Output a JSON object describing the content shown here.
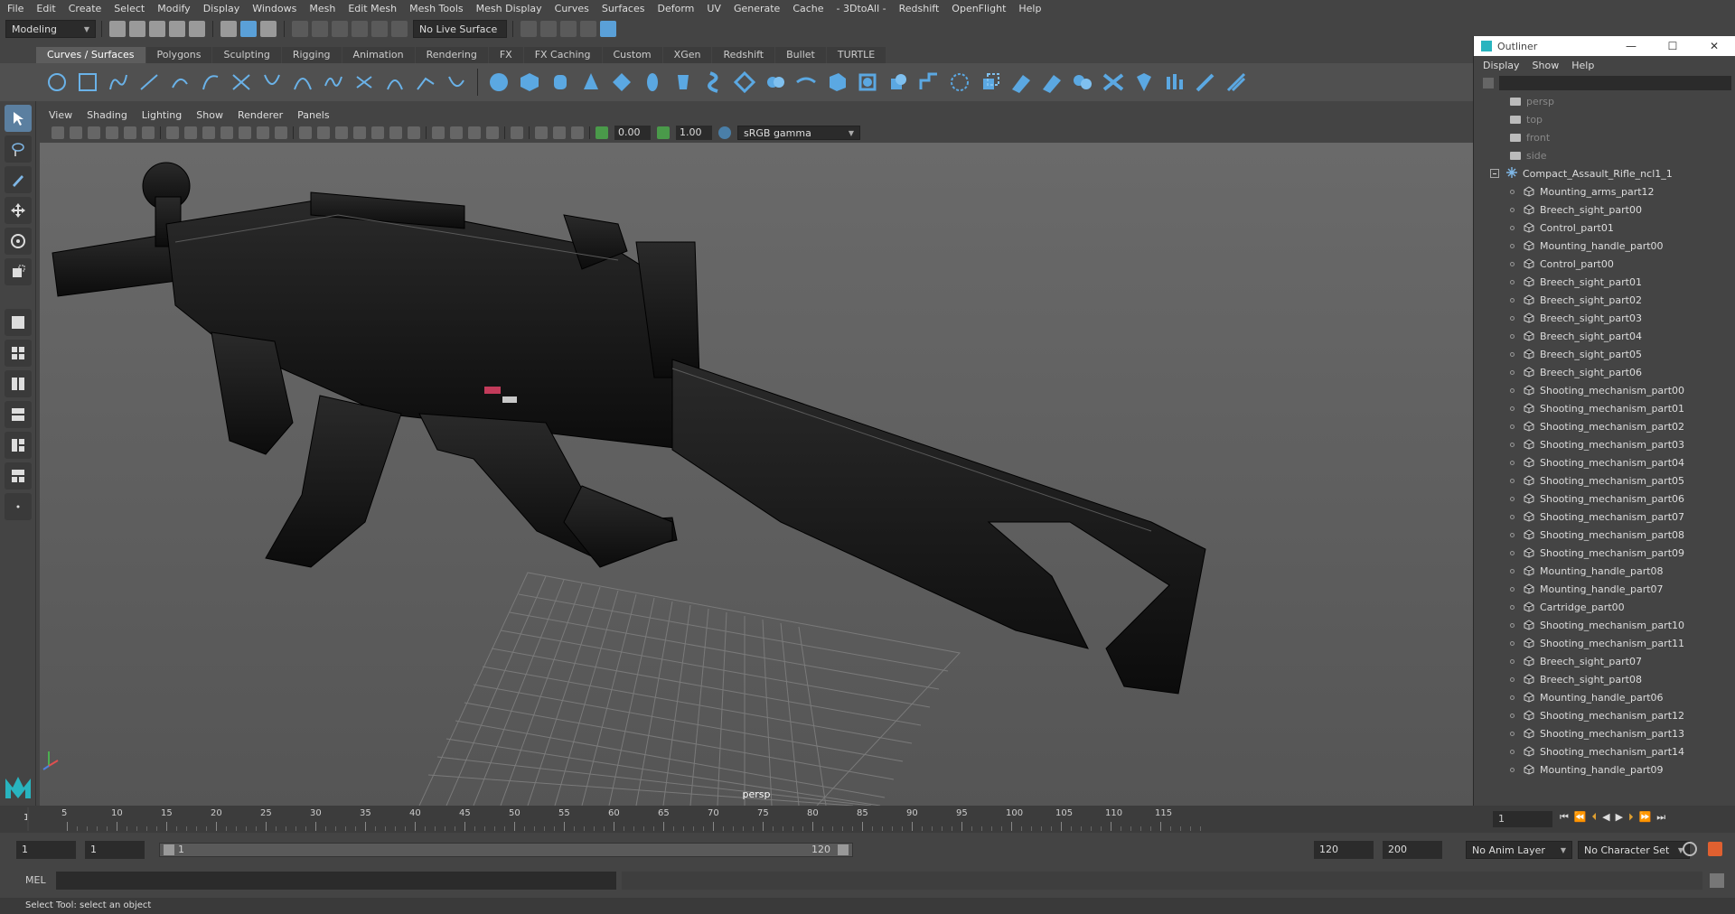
{
  "menubar": [
    "File",
    "Edit",
    "Create",
    "Select",
    "Modify",
    "Display",
    "Windows",
    "Mesh",
    "Edit Mesh",
    "Mesh Tools",
    "Mesh Display",
    "Curves",
    "Surfaces",
    "Deform",
    "UV",
    "Generate",
    "Cache",
    "- 3DtoAll -",
    "Redshift",
    "OpenFlight",
    "Help"
  ],
  "status": {
    "workspace": "Modeling",
    "live_surface": "No Live Surface"
  },
  "shelf_tabs": [
    "Curves / Surfaces",
    "Polygons",
    "Sculpting",
    "Rigging",
    "Animation",
    "Rendering",
    "FX",
    "FX Caching",
    "Custom",
    "XGen",
    "Redshift",
    "Bullet",
    "TURTLE"
  ],
  "view_menu": [
    "View",
    "Shading",
    "Lighting",
    "Show",
    "Renderer",
    "Panels"
  ],
  "view_tools": {
    "exposure": "0.00",
    "gamma": "1.00",
    "color_space": "sRGB gamma"
  },
  "viewport": {
    "camera_label": "persp"
  },
  "outliner": {
    "title": "Outliner",
    "window_buttons": [
      "—",
      "☐",
      "✕"
    ],
    "menu": [
      "Display",
      "Show",
      "Help"
    ],
    "cameras": [
      "persp",
      "top",
      "front",
      "side"
    ],
    "root": "Compact_Assault_Rifle_ncl1_1",
    "children": [
      "Mounting_arms_part12",
      "Breech_sight_part00",
      "Control_part01",
      "Mounting_handle_part00",
      "Control_part00",
      "Breech_sight_part01",
      "Breech_sight_part02",
      "Breech_sight_part03",
      "Breech_sight_part04",
      "Breech_sight_part05",
      "Breech_sight_part06",
      "Shooting_mechanism_part00",
      "Shooting_mechanism_part01",
      "Shooting_mechanism_part02",
      "Shooting_mechanism_part03",
      "Shooting_mechanism_part04",
      "Shooting_mechanism_part05",
      "Shooting_mechanism_part06",
      "Shooting_mechanism_part07",
      "Shooting_mechanism_part08",
      "Shooting_mechanism_part09",
      "Mounting_handle_part08",
      "Mounting_handle_part07",
      "Cartridge_part00",
      "Shooting_mechanism_part10",
      "Shooting_mechanism_part11",
      "Breech_sight_part07",
      "Breech_sight_part08",
      "Mounting_handle_part06",
      "Shooting_mechanism_part12",
      "Shooting_mechanism_part13",
      "Shooting_mechanism_part14",
      "Mounting_handle_part09"
    ]
  },
  "timeline": {
    "ticks": [
      "5",
      "10",
      "15",
      "20",
      "25",
      "30",
      "35",
      "40",
      "45",
      "50",
      "55",
      "60",
      "65",
      "70",
      "75",
      "80",
      "85",
      "90",
      "95",
      "100",
      "105",
      "110",
      "115"
    ],
    "start_marker": "1",
    "current_frame": "1"
  },
  "range": {
    "start": "1",
    "playback_start": "1",
    "slider_start": "1",
    "slider_end": "120",
    "playback_end": "120",
    "end": "200",
    "anim_layer": "No Anim Layer",
    "character_set": "No Character Set"
  },
  "cmdline": {
    "lang": "MEL"
  },
  "help_line": "Select Tool: select an object"
}
